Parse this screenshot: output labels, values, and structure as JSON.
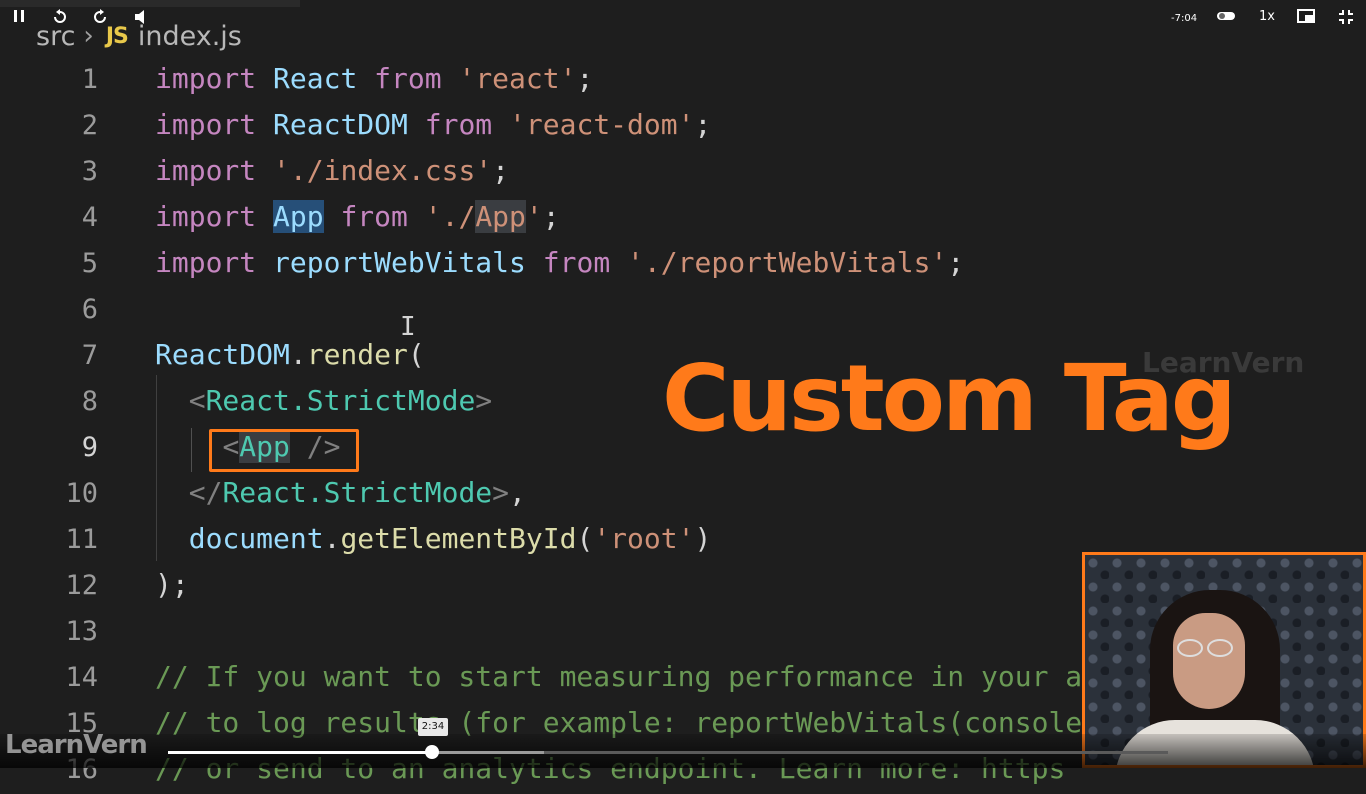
{
  "breadcrumb": {
    "folder": "src",
    "file_icon": "JS",
    "file": "index.js"
  },
  "lines": [
    {
      "n": "1",
      "tokens": [
        [
          "k",
          "import"
        ],
        [
          "p",
          " "
        ],
        [
          "v",
          "React"
        ],
        [
          "p",
          " "
        ],
        [
          "k",
          "from"
        ],
        [
          "p",
          " "
        ],
        [
          "s",
          "'react'"
        ],
        [
          "p",
          ";"
        ]
      ]
    },
    {
      "n": "2",
      "tokens": [
        [
          "k",
          "import"
        ],
        [
          "p",
          " "
        ],
        [
          "v",
          "ReactDOM"
        ],
        [
          "p",
          " "
        ],
        [
          "k",
          "from"
        ],
        [
          "p",
          " "
        ],
        [
          "s",
          "'react-dom'"
        ],
        [
          "p",
          ";"
        ]
      ]
    },
    {
      "n": "3",
      "tokens": [
        [
          "k",
          "import"
        ],
        [
          "p",
          " "
        ],
        [
          "s",
          "'./index.css'"
        ],
        [
          "p",
          ";"
        ]
      ]
    },
    {
      "n": "4",
      "tokens": [
        [
          "k",
          "import"
        ],
        [
          "p",
          " "
        ],
        [
          "v hl",
          "App"
        ],
        [
          "p",
          " "
        ],
        [
          "k",
          "from"
        ],
        [
          "p",
          " "
        ],
        [
          "s",
          "'./"
        ],
        [
          "s hl2",
          "App"
        ],
        [
          "s",
          "'"
        ],
        [
          "p",
          ";"
        ]
      ]
    },
    {
      "n": "5",
      "tokens": [
        [
          "k",
          "import"
        ],
        [
          "p",
          " "
        ],
        [
          "v",
          "reportWebVitals"
        ],
        [
          "p",
          " "
        ],
        [
          "k",
          "from"
        ],
        [
          "p",
          " "
        ],
        [
          "s",
          "'./reportWebVitals'"
        ],
        [
          "p",
          ";"
        ]
      ]
    },
    {
      "n": "6",
      "tokens": []
    },
    {
      "n": "7",
      "tokens": [
        [
          "v",
          "ReactDOM"
        ],
        [
          "p",
          "."
        ],
        [
          "f",
          "render"
        ],
        [
          "p",
          "("
        ]
      ]
    },
    {
      "n": "8",
      "tokens": [
        [
          "p",
          "  "
        ],
        [
          "tg",
          "<"
        ],
        [
          "t",
          "React.StrictMode"
        ],
        [
          "tg",
          ">"
        ]
      ]
    },
    {
      "n": "9",
      "tokens": [
        [
          "p",
          "    "
        ],
        [
          "tg",
          "<"
        ],
        [
          "t hl2",
          "App"
        ],
        [
          "tg",
          " />"
        ]
      ]
    },
    {
      "n": "10",
      "tokens": [
        [
          "p",
          "  "
        ],
        [
          "tg",
          "</"
        ],
        [
          "t",
          "React.StrictMode"
        ],
        [
          "tg",
          ">"
        ],
        [
          "p",
          ","
        ]
      ]
    },
    {
      "n": "11",
      "tokens": [
        [
          "p",
          "  "
        ],
        [
          "v",
          "document"
        ],
        [
          "p",
          "."
        ],
        [
          "f",
          "getElementById"
        ],
        [
          "p",
          "("
        ],
        [
          "s",
          "'root'"
        ],
        [
          "p",
          ")"
        ]
      ]
    },
    {
      "n": "12",
      "tokens": [
        [
          "p",
          ");"
        ]
      ]
    },
    {
      "n": "13",
      "tokens": []
    },
    {
      "n": "14",
      "tokens": [
        [
          "c",
          "// If you want to start measuring performance in your a"
        ]
      ]
    },
    {
      "n": "15",
      "tokens": [
        [
          "c",
          "// to log results (for example: reportWebVitals(console"
        ]
      ]
    },
    {
      "n": "16",
      "tokens": [
        [
          "c",
          "// or send to an analytics endpoint. Learn more: https"
        ]
      ]
    }
  ],
  "active_line": "9",
  "overlay": {
    "title": "Custom Tag",
    "watermark": "LearnVern"
  },
  "player": {
    "logo": "LearnVern",
    "tooltip_time": "2:34",
    "remaining_time": "-7:04",
    "speed": "1x",
    "progress_fraction": 0.264,
    "buffered_fraction": 0.376,
    "icons": [
      "pause-icon",
      "replay-icon",
      "forward-icon",
      "volume-icon",
      "toggle-icon",
      "pip-icon",
      "fullscreen-exit-icon"
    ]
  },
  "colors": {
    "accent": "#ff7a1a",
    "editor_bg": "#1e1e1e"
  }
}
